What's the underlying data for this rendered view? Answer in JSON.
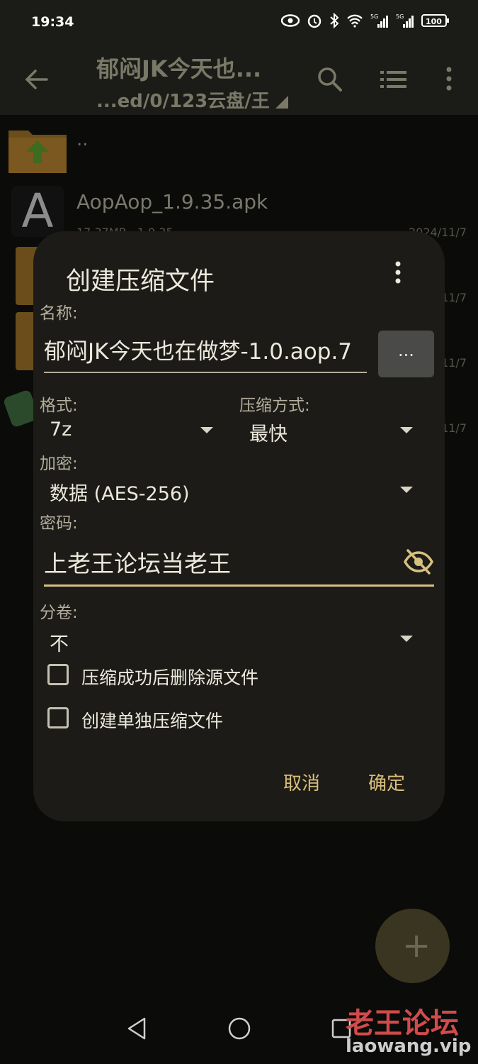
{
  "status_bar": {
    "time": "19:34",
    "battery": "100",
    "signal_1": "5G",
    "signal_2": "5G"
  },
  "app_bar": {
    "title": "郁闷JK今天也...",
    "path": "...ed/0/123云盘/王"
  },
  "file_list": {
    "parent_label": "..",
    "apk": {
      "name": "AopAop_1.9.35.apk",
      "meta": "17.37MB · 1.9.35",
      "date": "2024/11/7"
    },
    "date_2": "11/7",
    "date_3": "11/7",
    "date_4": "11/7"
  },
  "dialog": {
    "title": "创建压缩文件",
    "name_label": "名称:",
    "name_value": "郁闷JK今天也在做梦-1.0.aop.7",
    "browse_label": "...",
    "format_label": "格式:",
    "format_value": "7z",
    "compression_label": "压缩方式:",
    "compression_value": "最快",
    "encryption_label": "加密:",
    "encryption_value": "数据 (AES-256)",
    "password_label": "密码:",
    "password_value": "上老王论坛当老王",
    "split_label": "分卷:",
    "split_value": "不",
    "checkbox_delete": "压缩成功后删除源文件",
    "checkbox_separate": "创建单独压缩文件",
    "cancel": "取消",
    "ok": "确定"
  },
  "fab": {
    "label": "+"
  },
  "watermark": {
    "cn": "老王论坛",
    "en": "laowang.vip"
  },
  "colors": {
    "accent": "#d9bf7d",
    "dialog_bg": "#1c1b17",
    "app_bar_bg": "#1b1c18"
  }
}
